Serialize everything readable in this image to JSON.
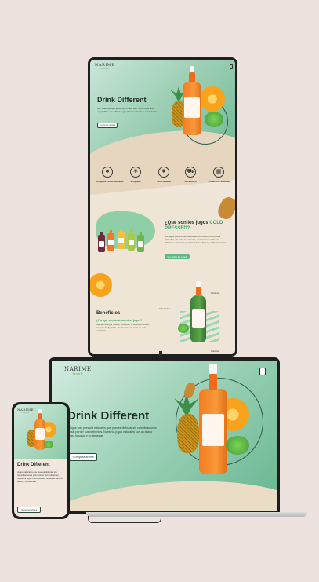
{
  "brand": {
    "name": "NARIME",
    "tagline": "fresh",
    "accent": "#3aa36c",
    "hero_green": "#8fcfa8",
    "sand": "#e6d6c0"
  },
  "hero": {
    "title": "Drink Different",
    "body": "Our cold-pressed juices are made with fresh fruits and vegetables, no added sugar. Real nutrients in every bottle.",
    "body_laptop": "Jugos cold pressed naturales que puedes disfrutar sin complicaciones y sin perder sus nutrientes. Nuestros jugos naturales son un aliado para tu salud y tu bienestar.",
    "body_phone": "Jugos naturales que puedes disfrutar sin complicaciones y sin perder sus nutrientes. Nuestros jugos naturales son un aliado para tu salud y tu bienestar.",
    "cta": "Comprar ahora"
  },
  "features": [
    {
      "icon": "leaf-icon",
      "glyph": "♣",
      "label": "Amigable con el ambiente"
    },
    {
      "icon": "wheat-icon",
      "glyph": "✾",
      "label": "Sin gluten"
    },
    {
      "icon": "natural-icon",
      "glyph": "❦",
      "label": "100% Natural"
    },
    {
      "icon": "truck-icon",
      "glyph": "⛟",
      "label": "Sin lechero"
    },
    {
      "icon": "calendar-icon",
      "glyph": "▦",
      "label": "Producción Semanal"
    }
  ],
  "cold_pressed": {
    "title_main": "¿Qué son los jugos",
    "title_highlight": "COLD",
    "title_end": "PRESSED?",
    "body": "Los jugos cold pressed se extraen en frío con una prensa hidráulica, sin calor ni oxidación, conservando todas las vitaminas, minerales y enzimas de las frutas y verduras frescas.",
    "cta": "Ver todos los jugos"
  },
  "benefits": {
    "title": "Beneficios",
    "subtitle": "¿Por qué consumir nuestros jugos?",
    "body": "Aportan energía natural, fortalecen tu sistema inmune y mejoran tu digestión. Ideales para un estilo de vida saludable.",
    "callouts": [
      "Ingredientes",
      "Nutrientes",
      "Vitaminas"
    ]
  },
  "bottle_colors": [
    "#6b2c3e",
    "#f07b22",
    "#f4c23a",
    "#a8c94a",
    "#6fb44d"
  ]
}
